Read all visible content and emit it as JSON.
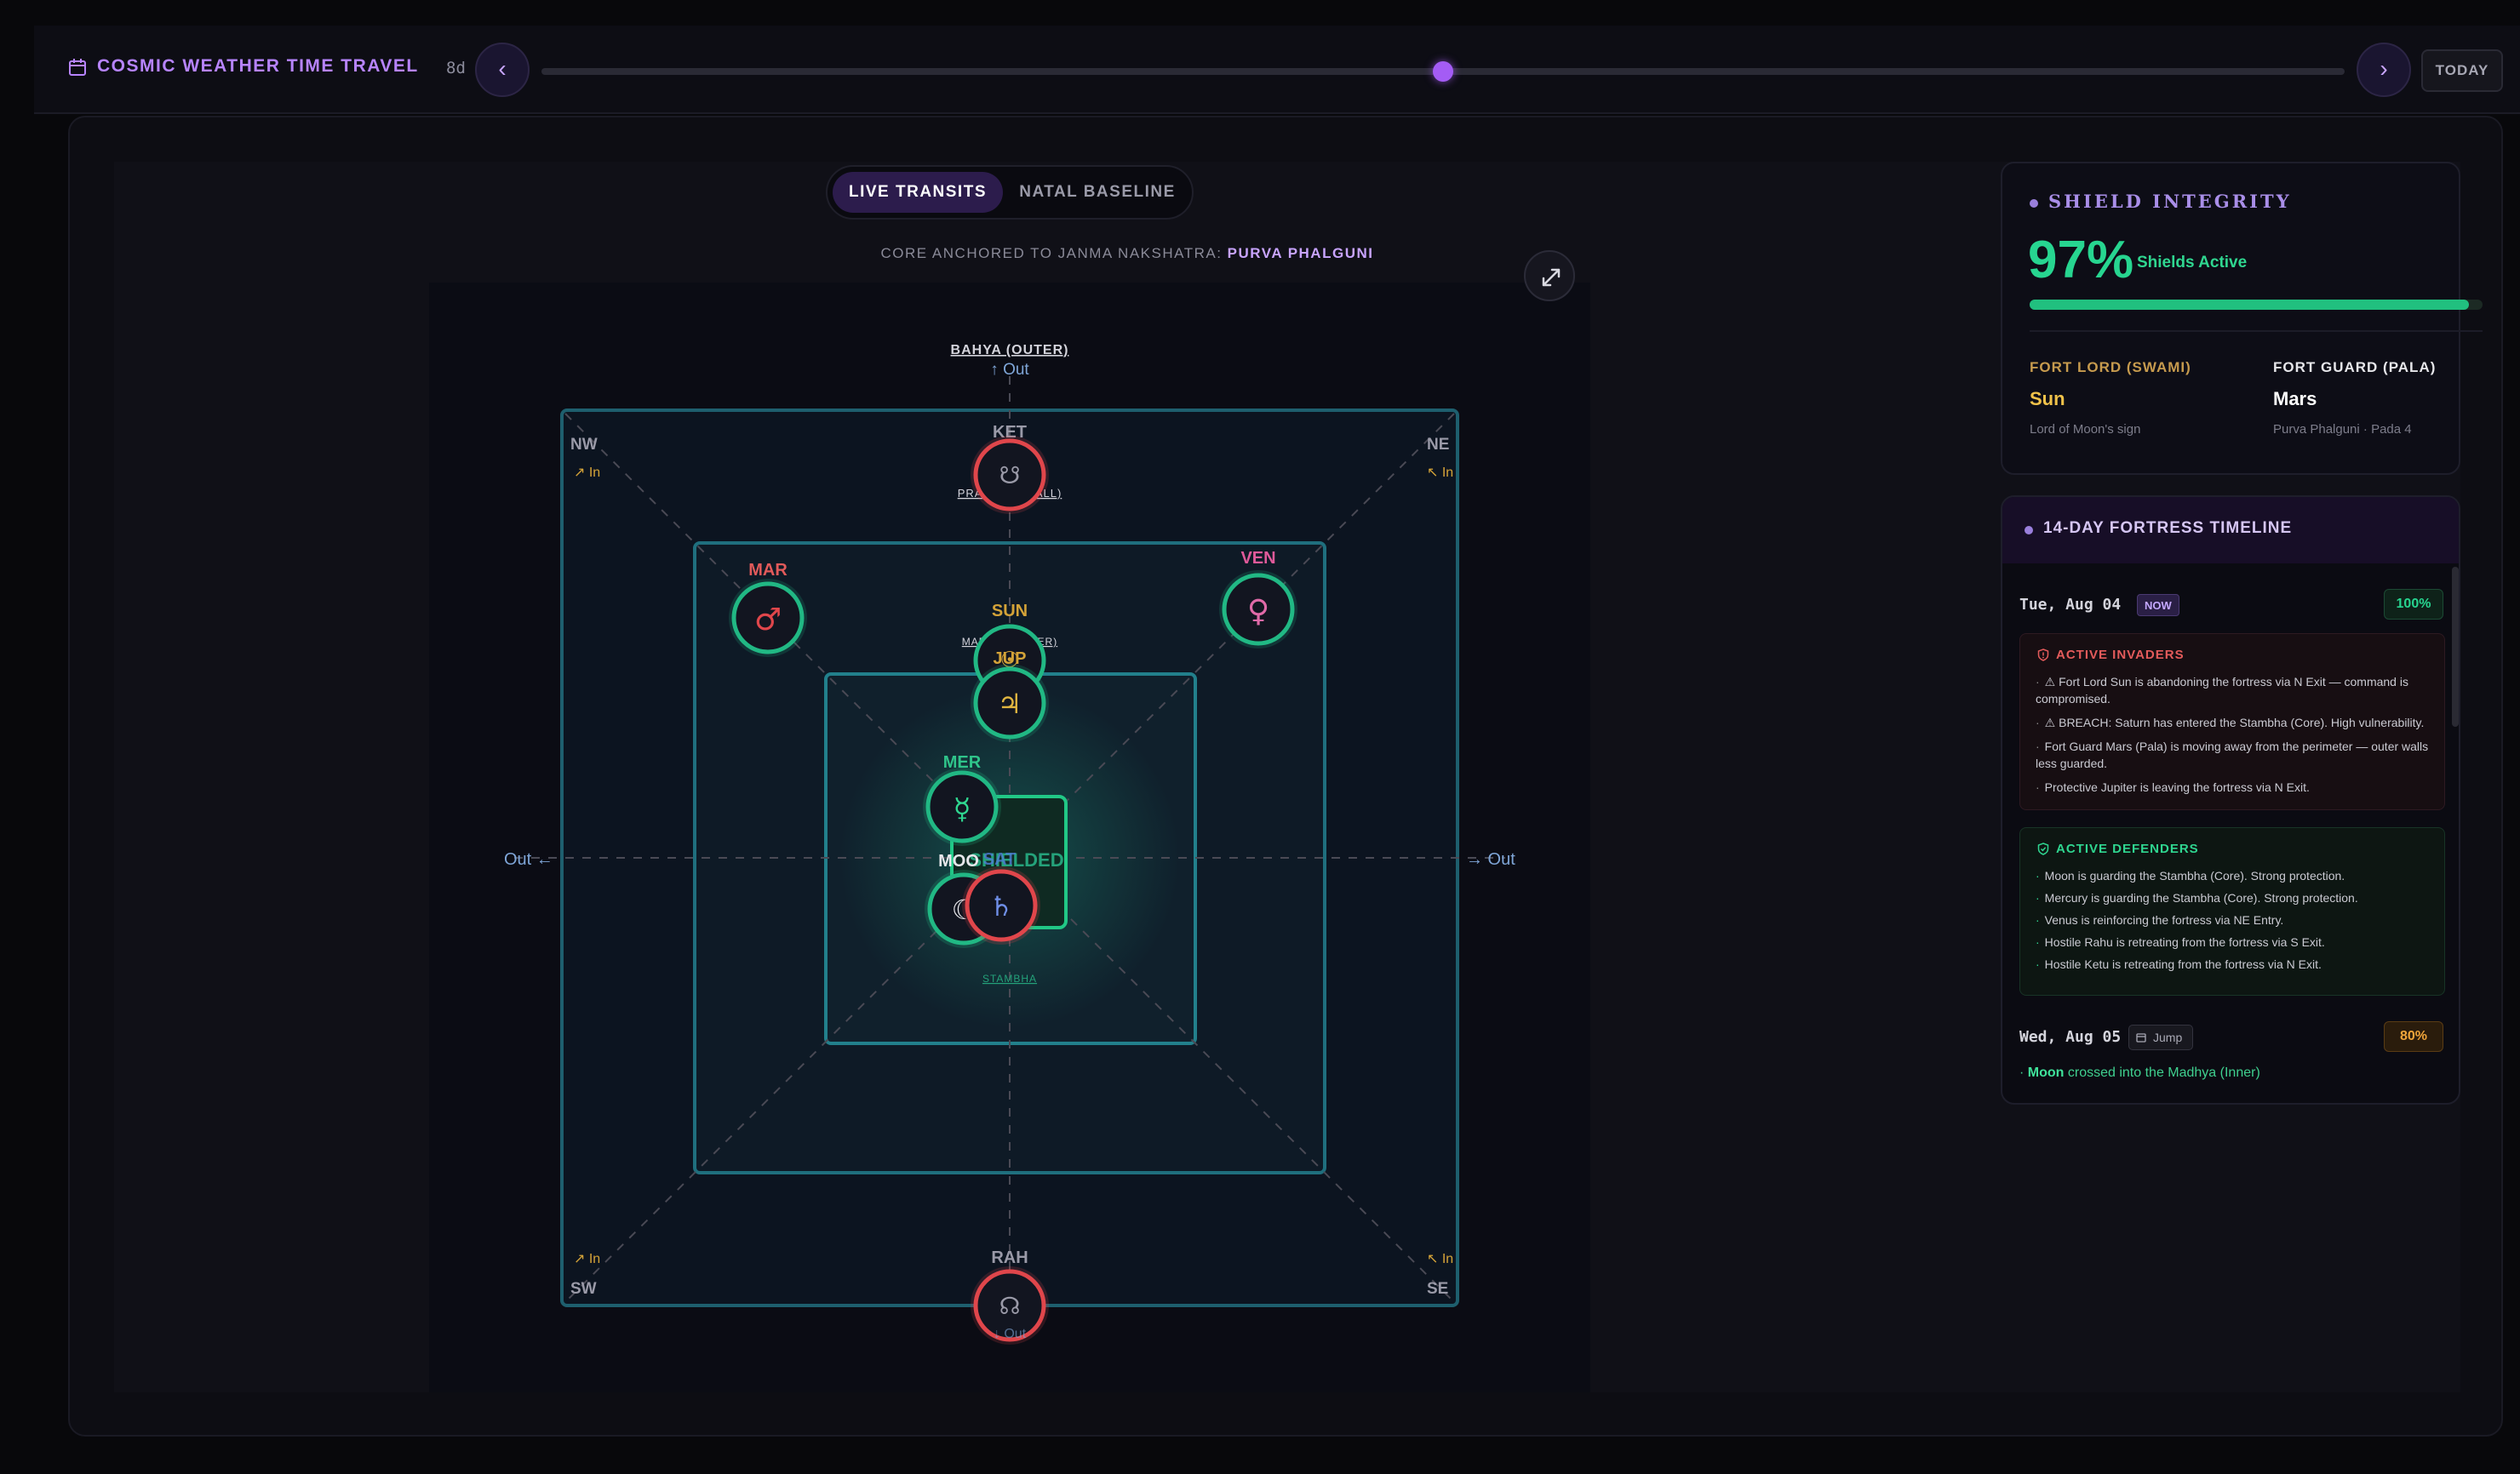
{
  "time_travel": {
    "title": "COSMIC WEATHER TIME TRAVEL",
    "offset": "8d",
    "prev_icon": "chevron-left-icon",
    "next_icon": "chevron-right-icon",
    "slider_fraction": 0.5,
    "today_label": "TODAY"
  },
  "mode_toggle": {
    "live": "LIVE TRANSITS",
    "natal": "NATAL BASELINE",
    "active": "live"
  },
  "anchor": {
    "prefix": "CORE ANCHORED TO JANMA NAKSHATRA: ",
    "value": "PURVA PHALGUNI"
  },
  "fortress": {
    "zones": {
      "outer": "BAHYA (OUTER)",
      "wall": "PRAKARA (WALL)",
      "inner": "MADHYA (INNER)",
      "core": "STAMBHA"
    },
    "outer_hint": "↑ Out",
    "left_exit": "Out ←",
    "right_exit": "→ Out",
    "bottom_hint": "↓ Out",
    "corners": {
      "nw": "NW",
      "ne": "NE",
      "sw": "SW",
      "se": "SE"
    },
    "corner_hint": "In",
    "shield_label": "SHIELDED",
    "planets": [
      {
        "abbr": "KET",
        "glyph": "☋",
        "state": "hostile"
      },
      {
        "abbr": "MAR",
        "glyph": "♂",
        "state": "friendly"
      },
      {
        "abbr": "VEN",
        "glyph": "♀",
        "state": "friendly"
      },
      {
        "abbr": "SUN",
        "glyph": "☉",
        "state": "friendly"
      },
      {
        "abbr": "JUP",
        "glyph": "♃",
        "state": "friendly"
      },
      {
        "abbr": "MER",
        "glyph": "☿",
        "state": "friendly"
      },
      {
        "abbr": "MOO",
        "glyph": "☾",
        "state": "friendly"
      },
      {
        "abbr": "SAT",
        "glyph": "♄",
        "state": "hostile"
      },
      {
        "abbr": "RAH",
        "glyph": "☊",
        "state": "hostile"
      }
    ],
    "colors": {
      "ring": "#1e5f6e",
      "friendly": "#21b884",
      "hostile": "#e0464b",
      "hint": "#d4a338"
    }
  },
  "shield": {
    "title": "SHIELD INTEGRITY",
    "percent": "97%",
    "percent_value": 0.97,
    "status": "Shields Active",
    "fort_lord_label": "FORT LORD (SWAMI)",
    "fort_lord": "Sun",
    "fort_lord_sub": "Lord of Moon's sign",
    "fort_guard_label": "FORT GUARD (PALA)",
    "fort_guard": "Mars",
    "fort_guard_sub": "Purva Phalguni · Pada 4"
  },
  "timeline": {
    "title": "14-DAY FORTRESS TIMELINE",
    "days": [
      {
        "date": "Tue, Aug 04",
        "badge": "NOW",
        "percent": "100%",
        "invaders_title": "ACTIVE INVADERS",
        "invaders": [
          "⚠ Fort Lord Sun is abandoning the fortress via N Exit — command is compromised.",
          "⚠ BREACH: Saturn has entered the Stambha (Core). High vulnerability.",
          "Fort Guard Mars (Pala) is moving away from the perimeter — outer walls less guarded.",
          "Protective Jupiter is leaving the fortress via N Exit."
        ],
        "defenders_title": "ACTIVE DEFENDERS",
        "defenders": [
          "Moon is guarding the Stambha (Core). Strong protection.",
          "Mercury is guarding the Stambha (Core). Strong protection.",
          "Venus is reinforcing the fortress via NE Entry.",
          "Hostile Rahu is retreating from the fortress via S Exit.",
          "Hostile Ketu is retreating from the fortress via N Exit."
        ]
      },
      {
        "date": "Wed, Aug 05",
        "jump_label": "Jump",
        "percent": "80%",
        "event_planet": "Moon",
        "event_text": " crossed into the Madhya (Inner)"
      }
    ]
  }
}
